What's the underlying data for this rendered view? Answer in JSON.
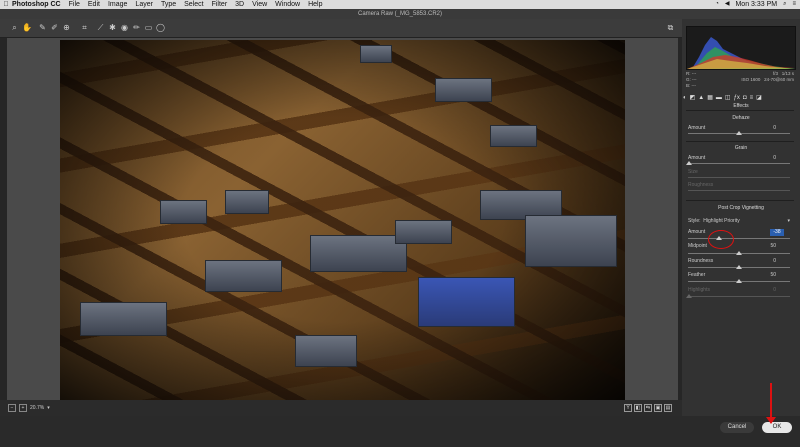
{
  "menubar": {
    "app": "Photoshop CC",
    "items": [
      "File",
      "Edit",
      "Image",
      "Layer",
      "Type",
      "Select",
      "Filter",
      "3D",
      "View",
      "Window",
      "Help"
    ],
    "clock": "Mon 3:33 PM"
  },
  "window": {
    "title": "Camera Raw (_MG_5853.CR2)"
  },
  "zoom_level": "20.7%",
  "histogram_meta": {
    "rgb_labels": [
      "R:",
      "G:",
      "B:"
    ],
    "values": [
      "---",
      "---",
      "---"
    ],
    "aperture": "f/3",
    "shutter": "1/13 s",
    "iso": "ISO 1600",
    "lens": "24-70@60 mm"
  },
  "panel": {
    "tab_title": "Effects",
    "dehaze": {
      "title": "Dehaze",
      "amount_label": "Amount",
      "amount_value": "0"
    },
    "grain": {
      "title": "Grain",
      "amount_label": "Amount",
      "amount_value": "0",
      "size_label": "Size",
      "roughness_label": "Roughness"
    },
    "vignetting": {
      "title": "Post Crop Vignetting",
      "style_label": "Style:",
      "style_value": "Highlight Priority",
      "amount_label": "Amount",
      "amount_value": "-38",
      "midpoint_label": "Midpoint",
      "midpoint_value": "50",
      "roundness_label": "Roundness",
      "roundness_value": "0",
      "feather_label": "Feather",
      "feather_value": "50",
      "highlights_label": "Highlights",
      "highlights_value": "0"
    }
  },
  "buttons": {
    "cancel": "Cancel",
    "ok": "OK"
  }
}
